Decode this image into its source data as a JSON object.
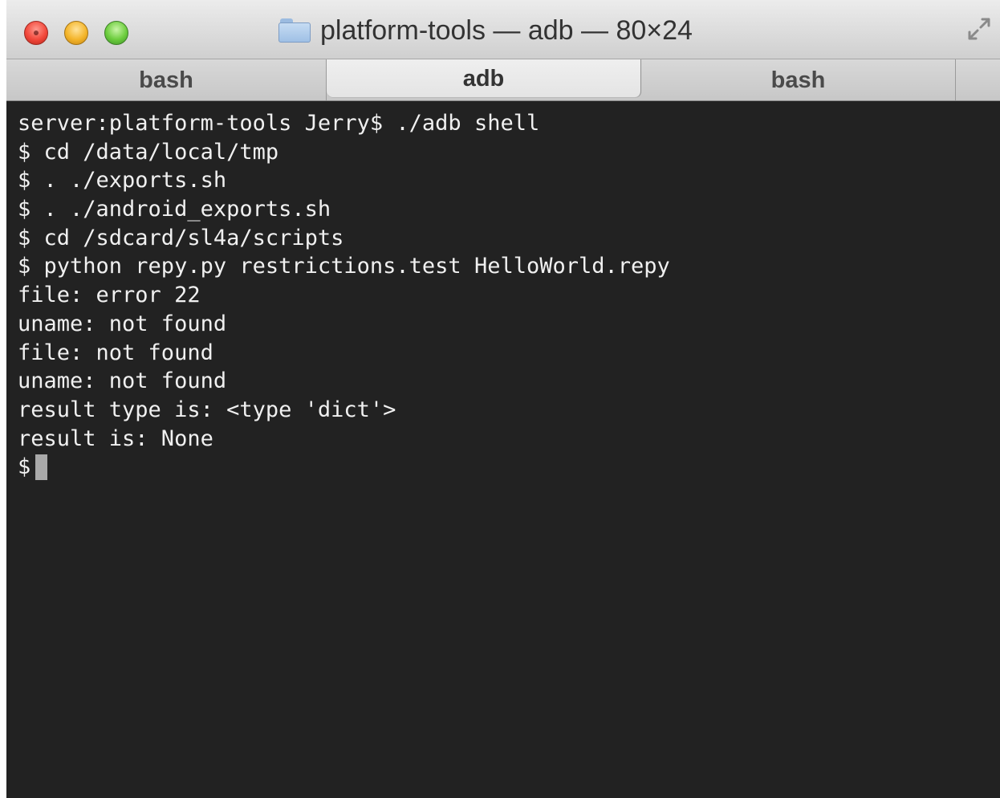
{
  "window": {
    "title": "platform-tools — adb — 80×24"
  },
  "tabs": [
    {
      "label": "bash",
      "active": false
    },
    {
      "label": "adb",
      "active": true
    },
    {
      "label": "bash",
      "active": false
    }
  ],
  "terminal": {
    "lines": [
      "server:platform-tools Jerry$ ./adb shell",
      "$ cd /data/local/tmp",
      "$ . ./exports.sh",
      "$ . ./android_exports.sh",
      "$ cd /sdcard/sl4a/scripts",
      "$ python repy.py restrictions.test HelloWorld.repy",
      "file: error 22",
      "uname: not found",
      "file: not found",
      "uname: not found",
      "result type is: <type 'dict'>",
      "result is: None"
    ],
    "prompt": "$"
  },
  "colors": {
    "terminal_background": "#222222",
    "terminal_text": "#f0f0f0",
    "cursor": "#a9a9a9",
    "close_button": "#f2483b",
    "minimize_button": "#f4b52a",
    "zoom_button": "#6ccd3d"
  },
  "icons": {
    "title": "folder-icon",
    "fullscreen": "fullscreen-icon"
  }
}
